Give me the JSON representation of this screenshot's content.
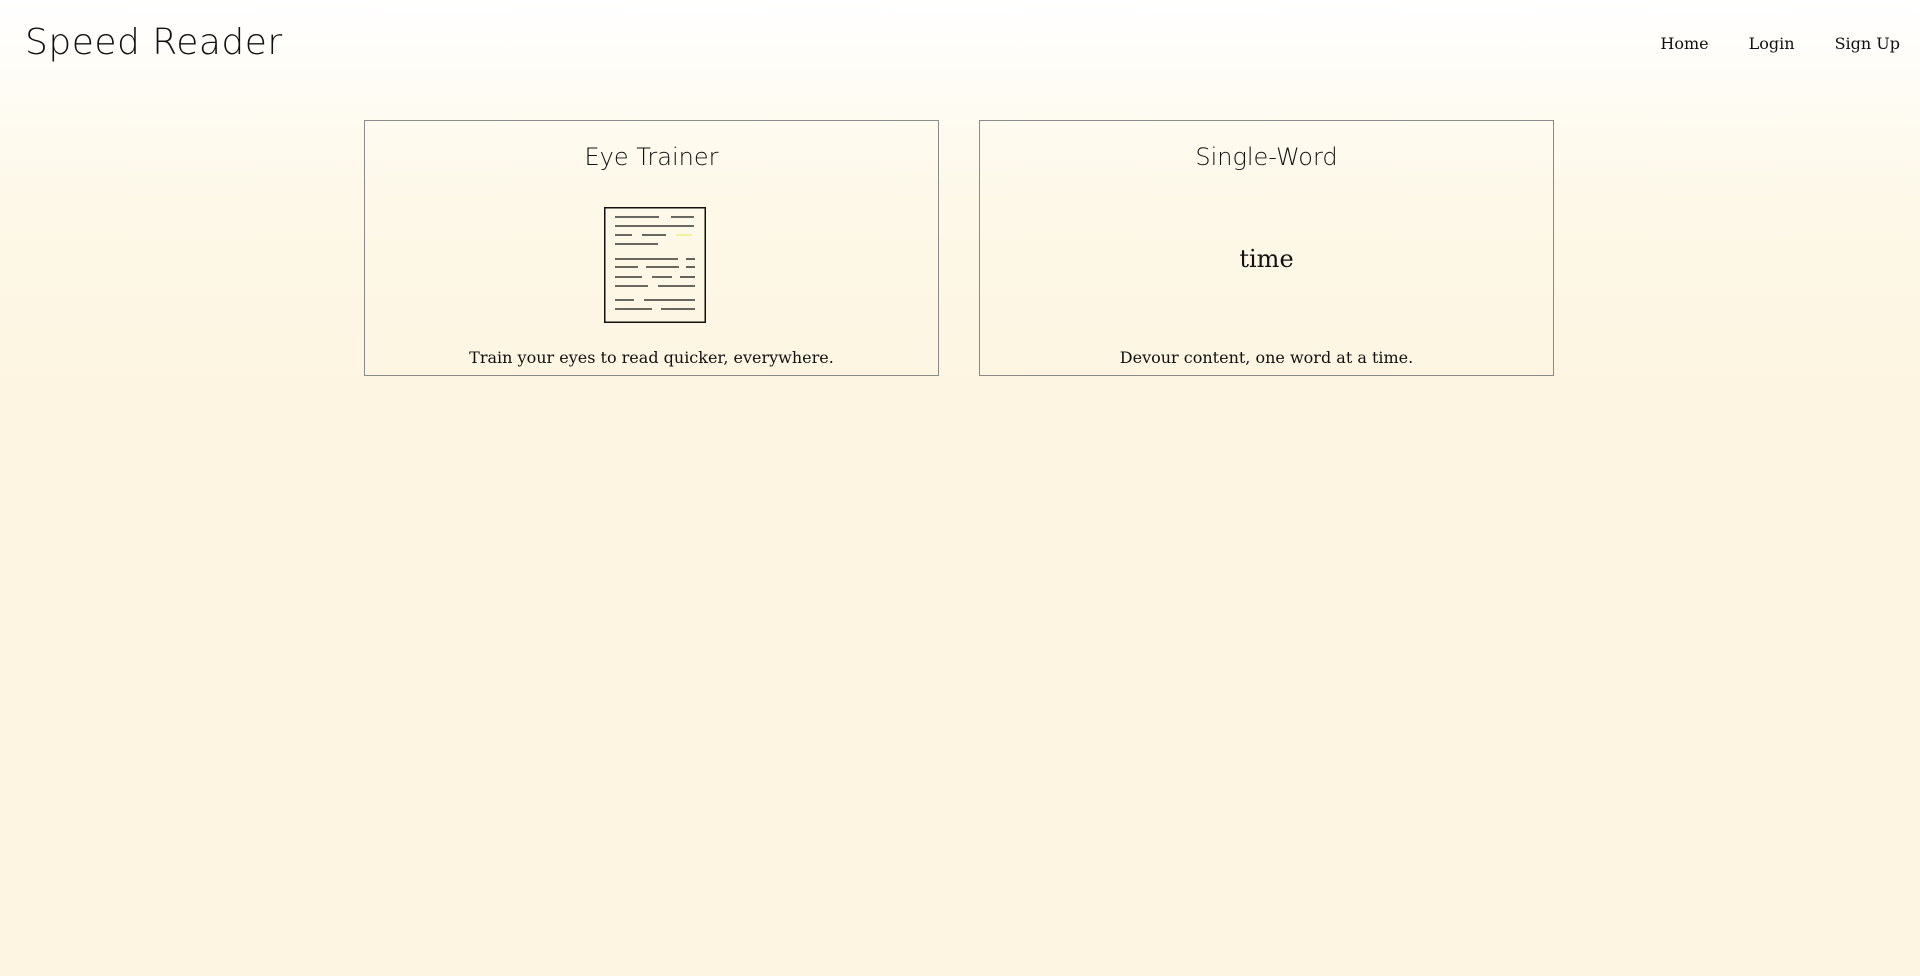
{
  "header": {
    "title": "Speed Reader",
    "nav": {
      "home": "Home",
      "login": "Login",
      "signup": "Sign Up"
    }
  },
  "cards": [
    {
      "title": "Eye Trainer",
      "icon": "document-lines-icon",
      "description": "Train your eyes to read quicker, everywhere."
    },
    {
      "title": "Single-Word",
      "word": "time",
      "description": "Devour content, one word at a time."
    }
  ],
  "colors": {
    "highlight": "#f2ee8a",
    "border": "#8a8a8a"
  }
}
